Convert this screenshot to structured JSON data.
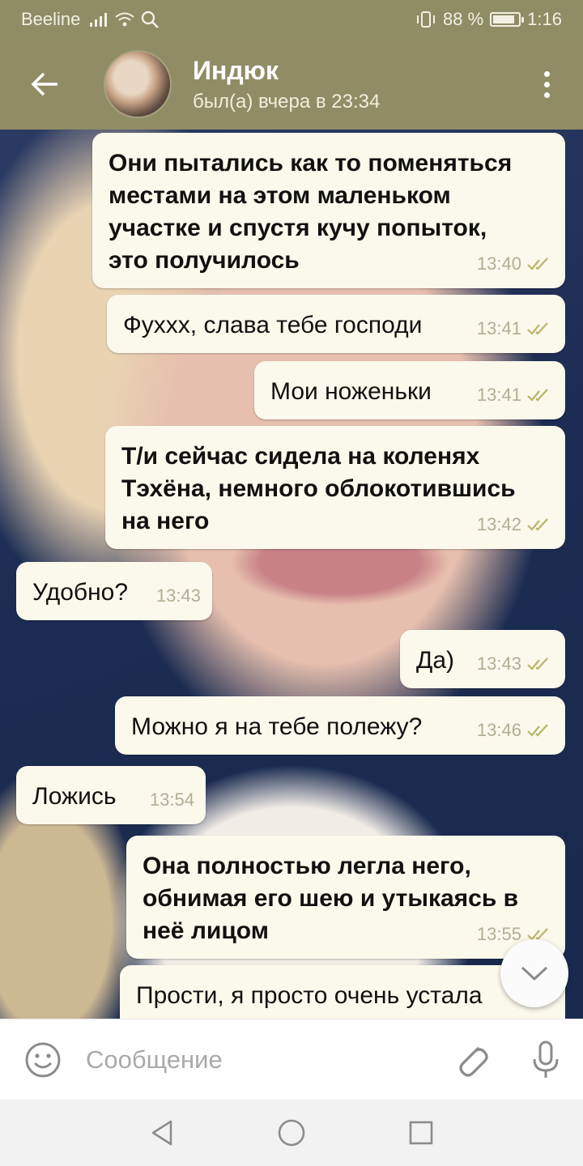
{
  "status_bar": {
    "carrier": "Beeline",
    "battery_text": "88 %",
    "battery_level": 0.88,
    "time": "1:16"
  },
  "header": {
    "contact_name": "Индюк",
    "last_seen": "был(а) вчера в 23:34"
  },
  "messages": [
    {
      "dir": "out",
      "bold": true,
      "text": "Они пытались как то поменяться\nместами на этом маленьком\nучастке и спустя кучу попыток,\nэто получилось",
      "time": "13:40",
      "read": true
    },
    {
      "dir": "out",
      "bold": false,
      "text": "Фуххх, слава тебе господи",
      "time": "13:41",
      "read": true
    },
    {
      "dir": "out",
      "bold": false,
      "text": "Мои ноженьки",
      "time": "13:41",
      "read": true
    },
    {
      "dir": "out",
      "bold": true,
      "text": "Т/и сейчас сидела на коленях\nТэхёна, немного облокотившись\nна него",
      "time": "13:42",
      "read": true
    },
    {
      "dir": "in",
      "bold": false,
      "text": "Удобно?",
      "time": "13:43"
    },
    {
      "dir": "out",
      "bold": false,
      "text": "Да)",
      "time": "13:43",
      "read": true
    },
    {
      "dir": "out",
      "bold": false,
      "text": "Можно я на тебе полежу?",
      "time": "13:46",
      "read": true
    },
    {
      "dir": "in",
      "bold": false,
      "text": "Ложись",
      "time": "13:54"
    },
    {
      "dir": "out",
      "bold": true,
      "text": "Она полностью легла него,\nобнимая его шею и утыкаясь в\nнеё лицом",
      "time": "13:55",
      "read": true
    },
    {
      "dir": "out",
      "bold": false,
      "text": "Прости, я просто очень устала",
      "time": "",
      "read": true
    }
  ],
  "input": {
    "placeholder": "Сообщение",
    "value": ""
  },
  "icons": {
    "back": "arrow-left-icon",
    "menu": "more-vert-icon",
    "emoji": "smiley-icon",
    "attach": "paperclip-icon",
    "mic": "microphone-icon",
    "scroll_down": "chevron-down-icon",
    "nav_back": "triangle-back-icon",
    "nav_home": "circle-home-icon",
    "nav_recent": "square-recent-icon"
  },
  "colors": {
    "header": "#908d66",
    "bubble": "#fbf8ec",
    "check": "#b9b46a"
  }
}
